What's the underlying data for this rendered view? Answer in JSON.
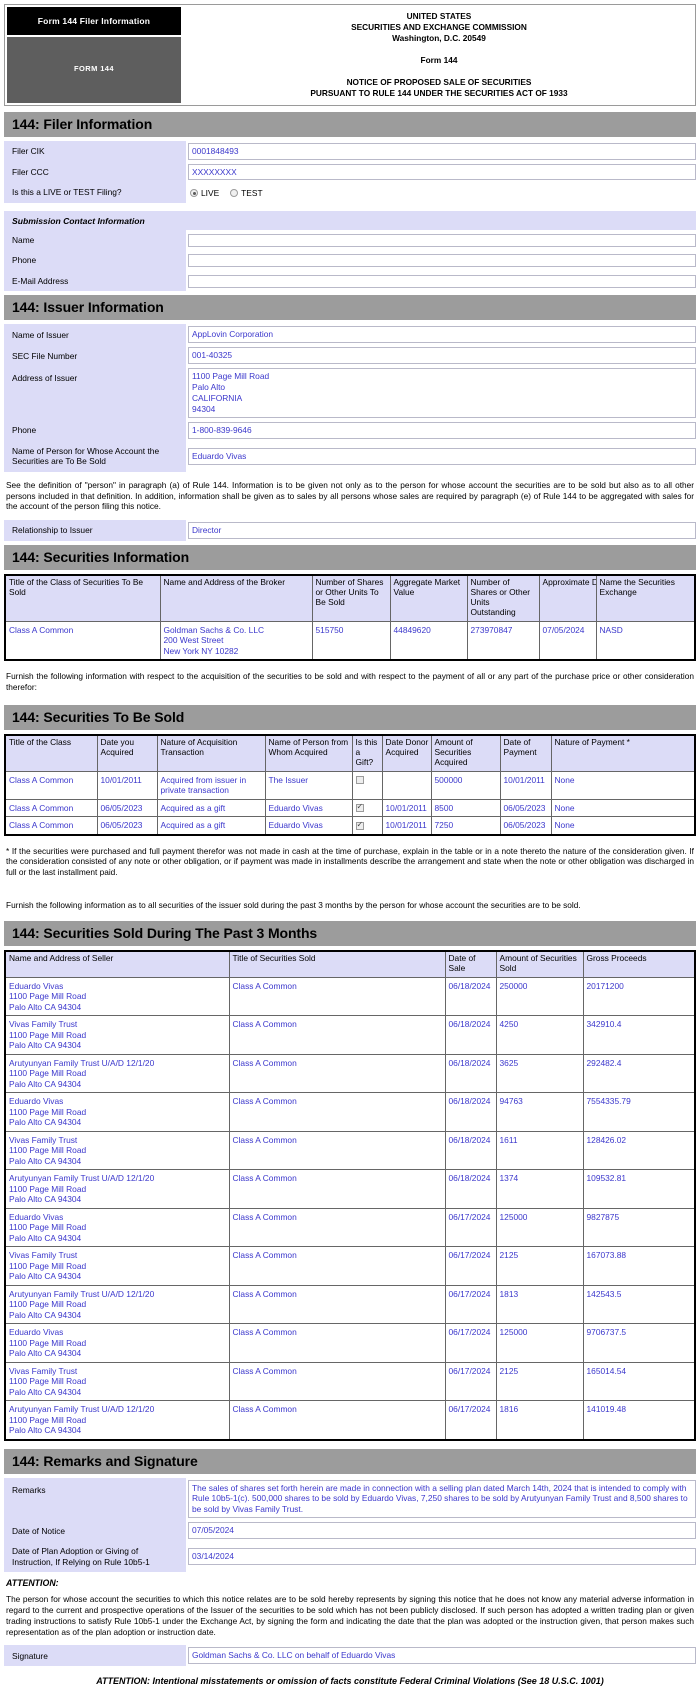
{
  "header": {
    "tab_label": "Form 144 Filer Information",
    "form_badge": "FORM 144",
    "line1": "UNITED STATES",
    "line2": "SECURITIES AND EXCHANGE COMMISSION",
    "line3": "Washington, D.C. 20549",
    "line4": "Form 144",
    "line5": "NOTICE OF PROPOSED SALE OF SECURITIES",
    "line6": "PURSUANT TO RULE 144 UNDER THE SECURITIES ACT OF 1933"
  },
  "filer_section": {
    "title": "144: Filer Information",
    "cik_label": "Filer CIK",
    "cik_value": "0001848493",
    "ccc_label": "Filer CCC",
    "ccc_value": "XXXXXXXX",
    "live_test_label": "Is this a LIVE or TEST Filing?",
    "live_label": "LIVE",
    "test_label": "TEST",
    "live_selected": true,
    "contact_subhead": "Submission Contact Information",
    "contact_name_label": "Name",
    "contact_name_value": "",
    "contact_phone_label": "Phone",
    "contact_phone_value": "",
    "contact_email_label": "E-Mail Address",
    "contact_email_value": ""
  },
  "issuer_section": {
    "title": "144: Issuer Information",
    "name_label": "Name of Issuer",
    "name_value": "AppLovin Corporation",
    "sec_file_label": "SEC File Number",
    "sec_file_value": "001-40325",
    "address_label": "Address of Issuer",
    "address_value": "1100 Page Mill Road\nPalo Alto\nCALIFORNIA\n94304",
    "phone_label": "Phone",
    "phone_value": "1-800-839-9646",
    "person_label": "Name of Person for Whose Account the Securities are To Be Sold",
    "person_value": "Eduardo Vivas",
    "person_note": "See the definition of \"person\" in paragraph (a) of Rule 144. Information is to be given not only as to the person for whose account the securities are to be sold but also as to all other persons included in that definition. In addition, information shall be given as to sales by all persons whose sales are required by paragraph (e) of Rule 144 to be aggregated with sales for the account of the person filing this notice.",
    "relationship_label": "Relationship to Issuer",
    "relationship_value": "Director"
  },
  "securities_info": {
    "title": "144: Securities Information",
    "columns": [
      "Title of the Class of Securities To Be Sold",
      "Name and Address of the Broker",
      "Number of Shares or Other Units To Be Sold",
      "Aggregate Market Value",
      "Number of Shares or Other Units Outstanding",
      "Approximate Date of Sale",
      "Name the Securities Exchange"
    ],
    "rows": [
      {
        "title": "Class A Common",
        "broker": "Goldman Sachs & Co. LLC\n200 West Street\nNew York   NY   10282",
        "units_to_be_sold": "515750",
        "market_value": "44849620",
        "units_outstanding": "273970847",
        "date_of_sale": "07/05/2024",
        "exchange": "NASD"
      }
    ],
    "furnish_note": "Furnish the following information with respect to the acquisition of the securities to be sold and with respect to the payment of all or any part of the purchase price or other consideration therefor:"
  },
  "securities_to_be_sold": {
    "title": "144: Securities To Be Sold",
    "columns": [
      "Title of the Class",
      "Date you Acquired",
      "Nature of Acquisition Transaction",
      "Name of Person from Whom Acquired",
      "Is this a Gift?",
      "Date Donor Acquired",
      "Amount of Securities Acquired",
      "Date of Payment",
      "Nature of Payment *"
    ],
    "rows": [
      {
        "title": "Class A Common",
        "date_acquired": "10/01/2011",
        "nature": "Acquired from issuer in private transaction",
        "from_whom": "The Issuer",
        "is_gift": false,
        "donor_date": "",
        "amount": "500000",
        "date_payment": "10/01/2011",
        "nature_payment": "None"
      },
      {
        "title": "Class A Common",
        "date_acquired": "06/05/2023",
        "nature": "Acquired as a gift",
        "from_whom": "Eduardo Vivas",
        "is_gift": true,
        "donor_date": "10/01/2011",
        "amount": "8500",
        "date_payment": "06/05/2023",
        "nature_payment": "None"
      },
      {
        "title": "Class A Common",
        "date_acquired": "06/05/2023",
        "nature": "Acquired as a gift",
        "from_whom": "Eduardo Vivas",
        "is_gift": true,
        "donor_date": "10/01/2011",
        "amount": "7250",
        "date_payment": "06/05/2023",
        "nature_payment": "None"
      }
    ],
    "footnote": "* If the securities were purchased and full payment therefor was not made in cash at the time of purchase, explain in the table or in a note thereto the nature of the consideration given. If the consideration consisted of any note or other obligation, or if payment was made in installments describe the arrangement and state when the note or other obligation was discharged in full or the last installment paid.",
    "intro_note": "Furnish the following information as to all securities of the issuer sold during the past 3 months by the person for whose account the securities are to be sold."
  },
  "securities_sold": {
    "title": "144: Securities Sold During The Past 3 Months",
    "columns": [
      "Name and Address of Seller",
      "Title of Securities Sold",
      "Date of Sale",
      "Amount of Securities Sold",
      "Gross Proceeds"
    ],
    "rows": [
      {
        "seller": "Eduardo Vivas\n1100 Page Mill Road\nPalo Alto   CA   94304",
        "title": "Class A Common",
        "date": "06/18/2024",
        "amount": "250000",
        "proceeds": "20171200"
      },
      {
        "seller": "Vivas Family Trust\n1100 Page Mill Road\nPalo Alto   CA   94304",
        "title": "Class A Common",
        "date": "06/18/2024",
        "amount": "4250",
        "proceeds": "342910.4"
      },
      {
        "seller": "Arutyunyan Family Trust U/A/D 12/1/20\n1100 Page Mill Road\nPalo Alto   CA   94304",
        "title": "Class A Common",
        "date": "06/18/2024",
        "amount": "3625",
        "proceeds": "292482.4"
      },
      {
        "seller": "Eduardo Vivas\n1100 Page Mill Road\nPalo Alto   CA   94304",
        "title": "Class A Common",
        "date": "06/18/2024",
        "amount": "94763",
        "proceeds": "7554335.79"
      },
      {
        "seller": "Vivas Family Trust\n1100 Page Mill Road\nPalo Alto   CA   94304",
        "title": "Class A Common",
        "date": "06/18/2024",
        "amount": "1611",
        "proceeds": "128426.02"
      },
      {
        "seller": "Arutyunyan Family Trust U/A/D 12/1/20\n1100 Page Mill Road\nPalo Alto   CA   94304",
        "title": "Class A Common",
        "date": "06/18/2024",
        "amount": "1374",
        "proceeds": "109532.81"
      },
      {
        "seller": "Eduardo Vivas\n1100 Page Mill Road\nPalo Alto   CA   94304",
        "title": "Class A Common",
        "date": "06/17/2024",
        "amount": "125000",
        "proceeds": "9827875"
      },
      {
        "seller": "Vivas Family Trust\n1100 Page Mill Road\nPalo Alto   CA   94304",
        "title": "Class A Common",
        "date": "06/17/2024",
        "amount": "2125",
        "proceeds": "167073.88"
      },
      {
        "seller": "Arutyunyan Family Trust U/A/D 12/1/20\n1100 Page Mill Road\nPalo Alto   CA   94304",
        "title": "Class A Common",
        "date": "06/17/2024",
        "amount": "1813",
        "proceeds": "142543.5"
      },
      {
        "seller": "Eduardo Vivas\n1100 Page Mill Road\nPalo Alto   CA   94304",
        "title": "Class A Common",
        "date": "06/17/2024",
        "amount": "125000",
        "proceeds": "9706737.5"
      },
      {
        "seller": "Vivas Family Trust\n1100 Page Mill Road\nPalo Alto   CA   94304",
        "title": "Class A Common",
        "date": "06/17/2024",
        "amount": "2125",
        "proceeds": "165014.54"
      },
      {
        "seller": "Arutyunyan Family Trust U/A/D 12/1/20\n1100 Page Mill Road\nPalo Alto   CA   94304",
        "title": "Class A Common",
        "date": "06/17/2024",
        "amount": "1816",
        "proceeds": "141019.48"
      }
    ]
  },
  "remarks_section": {
    "title": "144: Remarks and Signature",
    "remarks_label": "Remarks",
    "remarks_value": "The sales of shares set forth herein are made in connection with a selling plan dated March 14th, 2024 that is intended to comply with Rule 10b5-1(c). 500,000 shares to be sold by Eduardo Vivas, 7,250 shares to be sold by Arutyunyan Family Trust and 8,500 shares to be sold by Vivas Family Trust.",
    "date_notice_label": "Date of Notice",
    "date_notice_value": "07/05/2024",
    "plan_date_label": "Date of Plan Adoption or Giving of Instruction, If Relying on Rule 10b5-1",
    "plan_date_value": "03/14/2024",
    "attention_title": "ATTENTION:",
    "attention_body": "The person for whose account the securities to which this notice relates are to be sold hereby represents by signing this notice that he does not know any material adverse information in regard to the current and prospective operations of the Issuer of the securities to be sold which has not been publicly disclosed. If such person has adopted a written trading plan or given trading instructions to satisfy Rule 10b5-1 under the Exchange Act, by signing the form and indicating the date that the plan was adopted or the instruction given, that person makes such representation as of the plan adoption or instruction date.",
    "signature_label": "Signature",
    "signature_value": "Goldman Sachs & Co. LLC on behalf of Eduardo Vivas",
    "footer_attention": "ATTENTION: Intentional misstatements or omission of facts constitute Federal Criminal Violations (See 18 U.S.C. 1001)"
  },
  "colors": {
    "section_bar": "#9c9c9c",
    "label_bg": "#dcdcf7",
    "value_text": "#3b37cc",
    "tab_black": "#000000",
    "tab_gray": "#5e5e5e"
  }
}
